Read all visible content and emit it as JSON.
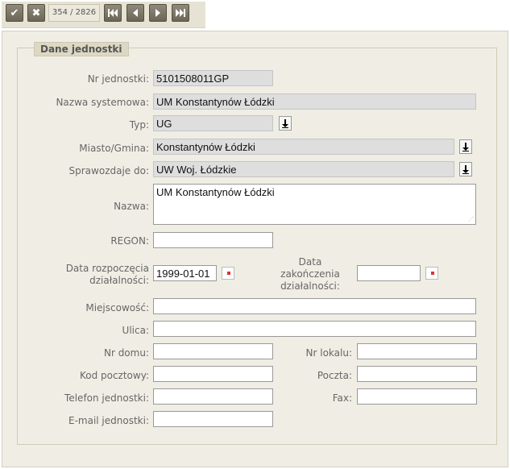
{
  "toolbar": {
    "accept_icon": "checkmark-icon",
    "cancel_icon": "x-icon",
    "counter": "354 / 2826",
    "nav": [
      "first-icon",
      "prev-icon",
      "next-icon",
      "last-icon"
    ]
  },
  "section": {
    "title": "Dane jednostki"
  },
  "form": {
    "nr_jednostki": {
      "label": "Nr jednostki:",
      "value": "5101508011GP"
    },
    "nazwa_systemowa": {
      "label": "Nazwa systemowa:",
      "value": "UM Konstantynów Łódzki"
    },
    "typ": {
      "label": "Typ:",
      "value": "UG"
    },
    "miasto_gmina": {
      "label": "Miasto/Gmina:",
      "value": "Konstantynów Łódzki"
    },
    "sprawozdaje_do": {
      "label": "Sprawozdaje do:",
      "value": "UW Woj. Łódzkie"
    },
    "nazwa": {
      "label": "Nazwa:",
      "value": "UM Konstantynów Łódzki"
    },
    "regon": {
      "label": "REGON:",
      "value": ""
    },
    "data_rozpoczecia": {
      "label_line1": "Data rozpoczęcia",
      "label_line2": "działalności:",
      "value": "1999-01-01"
    },
    "data_zakonczenia": {
      "label_line1": "Data",
      "label_line2": "zakończenia",
      "label_line3": "działalności:",
      "value": ""
    },
    "miejscowosc": {
      "label": "Miejscowość:",
      "value": ""
    },
    "ulica": {
      "label": "Ulica:",
      "value": ""
    },
    "nr_domu": {
      "label": "Nr domu:",
      "value": ""
    },
    "nr_lokalu": {
      "label": "Nr lokalu:",
      "value": ""
    },
    "kod_pocztowy": {
      "label": "Kod pocztowy:",
      "value": ""
    },
    "poczta": {
      "label": "Poczta:",
      "value": ""
    },
    "telefon": {
      "label": "Telefon jednostki:",
      "value": ""
    },
    "fax": {
      "label": "Fax:",
      "value": ""
    },
    "email": {
      "label": "E-mail jednostki:",
      "value": ""
    }
  },
  "colors": {
    "toolbar_bg": "#e6e3d5",
    "panel_bg": "#f0eee4",
    "button": "#7a7565",
    "readonly_field": "#dedede"
  }
}
